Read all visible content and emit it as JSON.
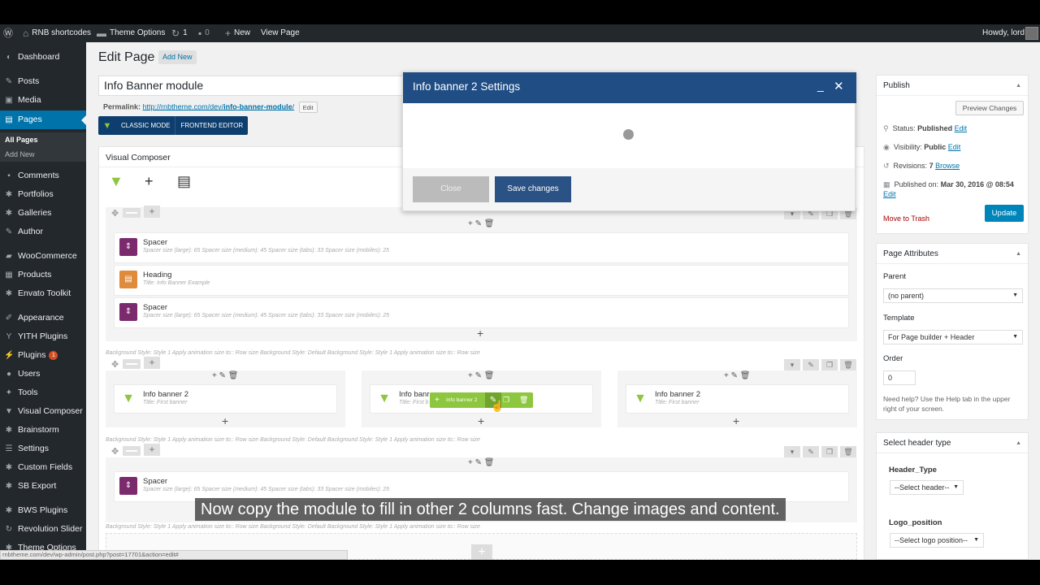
{
  "adminbar": {
    "site": "RNB shortcodes",
    "theme_options": "Theme Options",
    "updates": "1",
    "comments": "0",
    "new": "New",
    "view_page": "View Page",
    "howdy": "Howdy, lord"
  },
  "menu": {
    "items": [
      {
        "label": "Dashboard",
        "icon": "dashboard-icon"
      },
      {
        "label": "Posts",
        "icon": "pin-icon"
      },
      {
        "label": "Media",
        "icon": "media-icon"
      },
      {
        "label": "Pages",
        "icon": "pages-icon"
      },
      {
        "label": "Comments",
        "icon": "comment-icon"
      },
      {
        "label": "Portfolios",
        "icon": "gear-icon"
      },
      {
        "label": "Galleries",
        "icon": "gear-icon"
      },
      {
        "label": "Author",
        "icon": "pin-icon"
      },
      {
        "label": "WooCommerce",
        "icon": "woo-icon"
      },
      {
        "label": "Products",
        "icon": "products-icon"
      },
      {
        "label": "Envato Toolkit",
        "icon": "gear-icon"
      },
      {
        "label": "Appearance",
        "icon": "brush-icon"
      },
      {
        "label": "YITH Plugins",
        "icon": "yith-icon"
      },
      {
        "label": "Plugins",
        "icon": "plugin-icon",
        "badge": "1"
      },
      {
        "label": "Users",
        "icon": "user-icon"
      },
      {
        "label": "Tools",
        "icon": "wrench-icon"
      },
      {
        "label": "Visual Composer",
        "icon": "vc-icon"
      },
      {
        "label": "Brainstorm",
        "icon": "gear-icon"
      },
      {
        "label": "Settings",
        "icon": "settings-icon"
      },
      {
        "label": "Custom Fields",
        "icon": "gear-icon"
      },
      {
        "label": "SB Export",
        "icon": "gear-icon"
      },
      {
        "label": "BWS Plugins",
        "icon": "gear-icon"
      },
      {
        "label": "Revolution Slider",
        "icon": "slider-icon"
      },
      {
        "label": "Theme Options",
        "icon": "gear-icon"
      }
    ],
    "sub_all_pages": "All Pages",
    "sub_add_new": "Add New"
  },
  "main": {
    "heading": "Edit Page",
    "add_new": "Add New",
    "page_title_value": "Info Banner module",
    "permalink_label": "Permalink:",
    "permalink_base": "http://rnbtheme.com/dev/",
    "permalink_slug": "info-banner-module",
    "permalink_end": "/",
    "permalink_edit": "Edit",
    "classic_mode": "CLASSIC MODE",
    "frontend_editor": "FRONTEND EDITOR"
  },
  "vc": {
    "title": "Visual Composer",
    "bg_note": "Background Style: Style 1  Apply animation size to:: Row size  Background Style: Default  Background Style: Style 1  Apply animation size to:: Row size",
    "spacer_name": "Spacer",
    "spacer_desc": "Spacer size (large): 65  Spacer size (medium): 45  Spacer size (tabs): 33  Spacer size (mobiles): 25",
    "heading_name": "Heading",
    "heading_desc": "Title: Info Banner Example",
    "banner_name": "Info banner 2",
    "banner_name_short": "Info banr",
    "banner_desc": "Title: First banner",
    "banner_desc_short": "Title: First b",
    "green_label": "Info banner 2"
  },
  "publish": {
    "title": "Publish",
    "preview": "Preview Changes",
    "status_label": "Status:",
    "status_value": "Published",
    "visibility_label": "Visibility:",
    "visibility_value": "Public",
    "revisions_label": "Revisions:",
    "revisions_value": "7",
    "browse": "Browse",
    "published_label": "Published on:",
    "published_value": "Mar 30, 2016 @ 08:54",
    "edit": "Edit",
    "trash": "Move to Trash",
    "update": "Update"
  },
  "attributes": {
    "title": "Page Attributes",
    "parent_label": "Parent",
    "parent_value": "(no parent)",
    "template_label": "Template",
    "template_value": "For Page builder + Header",
    "order_label": "Order",
    "order_value": "0",
    "help": "Need help? Use the Help tab in the upper right of your screen."
  },
  "header_type": {
    "title": "Select header type",
    "header_type_label": "Header_Type",
    "header_type_value": "--Select header--",
    "logo_label": "Logo_position",
    "logo_value": "--Select logo position--"
  },
  "modal": {
    "title": "Info banner 2 Settings",
    "close": "Close",
    "save": "Save changes"
  },
  "subtitle": "Now copy the module to fill in other 2 columns fast. Change images and content.",
  "status_url": "rnbtheme.com/dev/wp-admin/post.php?post=17701&action=edit#"
}
